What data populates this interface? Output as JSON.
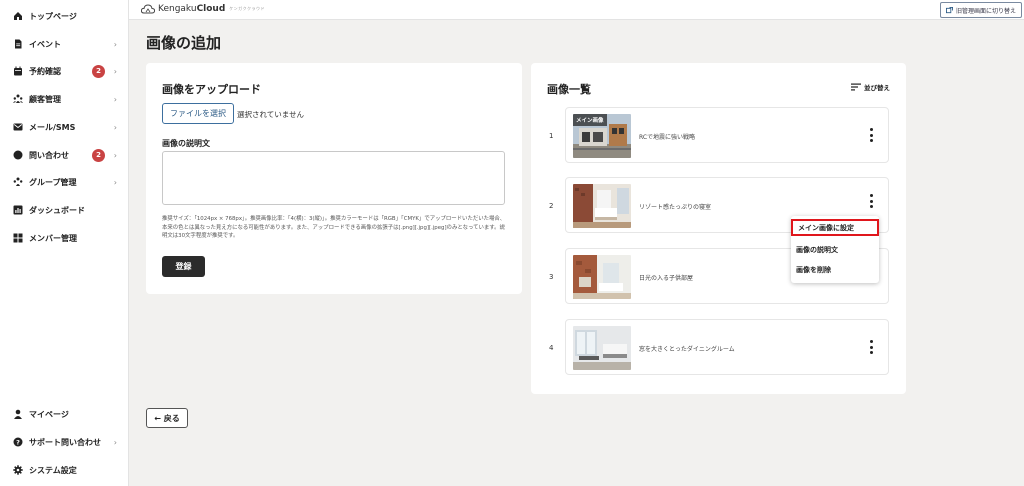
{
  "sidebar": {
    "items": [
      {
        "label": "トップページ",
        "icon": "home-icon",
        "chevron": false,
        "badge": ""
      },
      {
        "label": "イベント",
        "icon": "document-icon",
        "chevron": true,
        "badge": ""
      },
      {
        "label": "予約確認",
        "icon": "calendar-icon",
        "chevron": true,
        "badge": "2"
      },
      {
        "label": "顧客管理",
        "icon": "people-icon",
        "chevron": true,
        "badge": ""
      },
      {
        "label": "メール/SMS",
        "icon": "mail-icon",
        "chevron": true,
        "badge": ""
      },
      {
        "label": "問い合わせ",
        "icon": "chat-icon",
        "chevron": true,
        "badge": "2"
      },
      {
        "label": "グループ管理",
        "icon": "group-icon",
        "chevron": true,
        "badge": ""
      },
      {
        "label": "ダッシュボード",
        "icon": "chart-icon",
        "chevron": false,
        "badge": ""
      },
      {
        "label": "メンバー管理",
        "icon": "grid-icon",
        "chevron": false,
        "badge": ""
      }
    ],
    "bottom_items": [
      {
        "label": "マイページ",
        "icon": "person-icon",
        "chevron": false
      },
      {
        "label": "サポート問い合わせ",
        "icon": "help-icon",
        "chevron": true
      },
      {
        "label": "システム設定",
        "icon": "gear-icon",
        "chevron": false
      }
    ],
    "chevron_glyph": "›"
  },
  "header": {
    "logo_regular": "Kengaku",
    "logo_bold": "Cloud",
    "logo_sub": "ケンガククラウド",
    "switch_label": "旧管理画面に切り替え"
  },
  "page": {
    "title": "画像の追加",
    "back_label": "← 戻る"
  },
  "upload": {
    "title": "画像をアップロード",
    "file_button": "ファイルを選択",
    "file_status": "選択されていません",
    "desc_label": "画像の説明文",
    "desc_value": "",
    "notice": "推奨サイズ：「1024px × 768px」。推奨画像比率：「4(横)：3(縦)」。推奨カラーモードは「RGB」「CMYK」でアップロードいただいた場合、本来の色とは異なった見え方になる可能性があります。また、アップロードできる画像の拡張子は[.png][.jpg][.jpeg]のみとなっています。説明文は30文字程度が推奨です。",
    "submit": "登録"
  },
  "image_list": {
    "title": "画像一覧",
    "sort_label": "並び替え",
    "main_tag": "メイン画像",
    "rows": [
      {
        "num": "1",
        "caption": "RCで地震に強い戦略",
        "is_main": true
      },
      {
        "num": "2",
        "caption": "リゾート感たっぷりの寝室",
        "is_main": false
      },
      {
        "num": "3",
        "caption": "日光の入る子供部屋",
        "is_main": false
      },
      {
        "num": "4",
        "caption": "窓を大きくとったダイニングルーム",
        "is_main": false
      }
    ]
  },
  "context_menu": {
    "items": [
      "メイン画像に設定",
      "画像の説明文",
      "画像を削除"
    ],
    "highlight_color": "#e0161c"
  },
  "colors": {
    "badge": "#c94343",
    "accent": "#2b5a85",
    "background": "#f2f1ef"
  }
}
